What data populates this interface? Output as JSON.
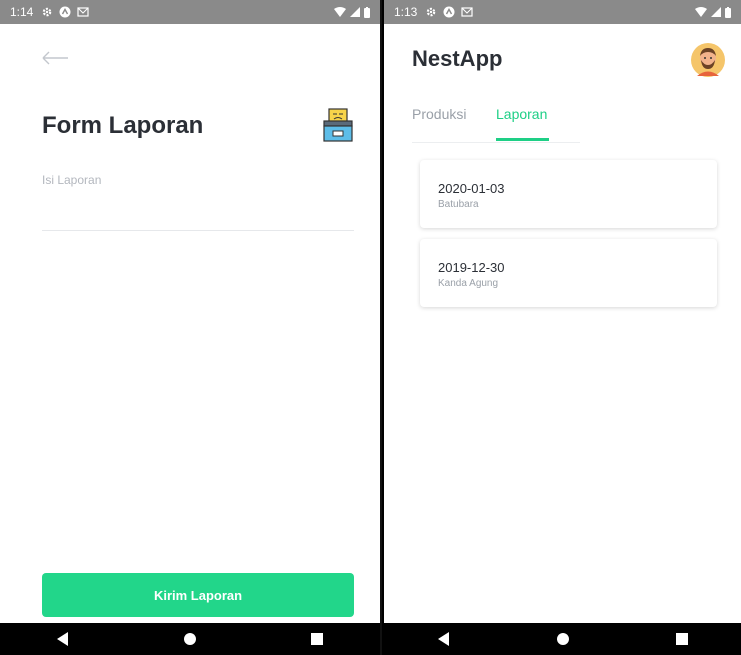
{
  "left_screen": {
    "status": {
      "time": "1:14"
    },
    "title": "Form Laporan",
    "field_placeholder": "Isi Laporan",
    "submit_label": "Kirim Laporan"
  },
  "right_screen": {
    "status": {
      "time": "1:13"
    },
    "app_title": "NestApp",
    "tabs": [
      {
        "label": "Produksi",
        "active": false
      },
      {
        "label": "Laporan",
        "active": true
      }
    ],
    "reports": [
      {
        "date": "2020-01-03",
        "author": "Batubara"
      },
      {
        "date": "2019-12-30",
        "author": "Kanda Agung"
      }
    ]
  },
  "colors": {
    "accent": "#22d68a",
    "title": "#2b2f36",
    "muted": "#9aa0a8",
    "statusbar": "#8a8a8a"
  },
  "icons": [
    "back-arrow-icon",
    "archive-box-icon",
    "avatar-icon",
    "settings-icon",
    "android-icon",
    "mail-icon",
    "wifi-icon",
    "signal-icon",
    "battery-icon",
    "nav-back-icon",
    "nav-home-icon",
    "nav-recents-icon"
  ]
}
